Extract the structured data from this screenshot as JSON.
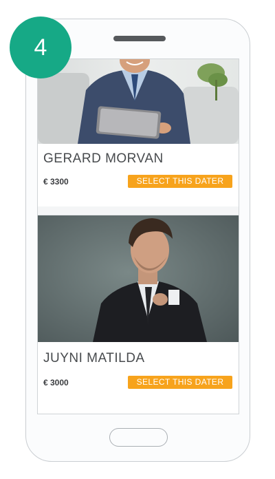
{
  "step": {
    "number": "4",
    "color": "#16a986"
  },
  "daters": [
    {
      "name": "GERARD MORVAN",
      "price": "€ 3300",
      "button_label": "SELECT THIS DATER"
    },
    {
      "name": "JUYNI MATILDA",
      "price": "€ 3000",
      "button_label": "SELECT THIS DATER"
    }
  ],
  "colors": {
    "accent_button": "#f7a31c",
    "text_dark": "#474a4d"
  }
}
